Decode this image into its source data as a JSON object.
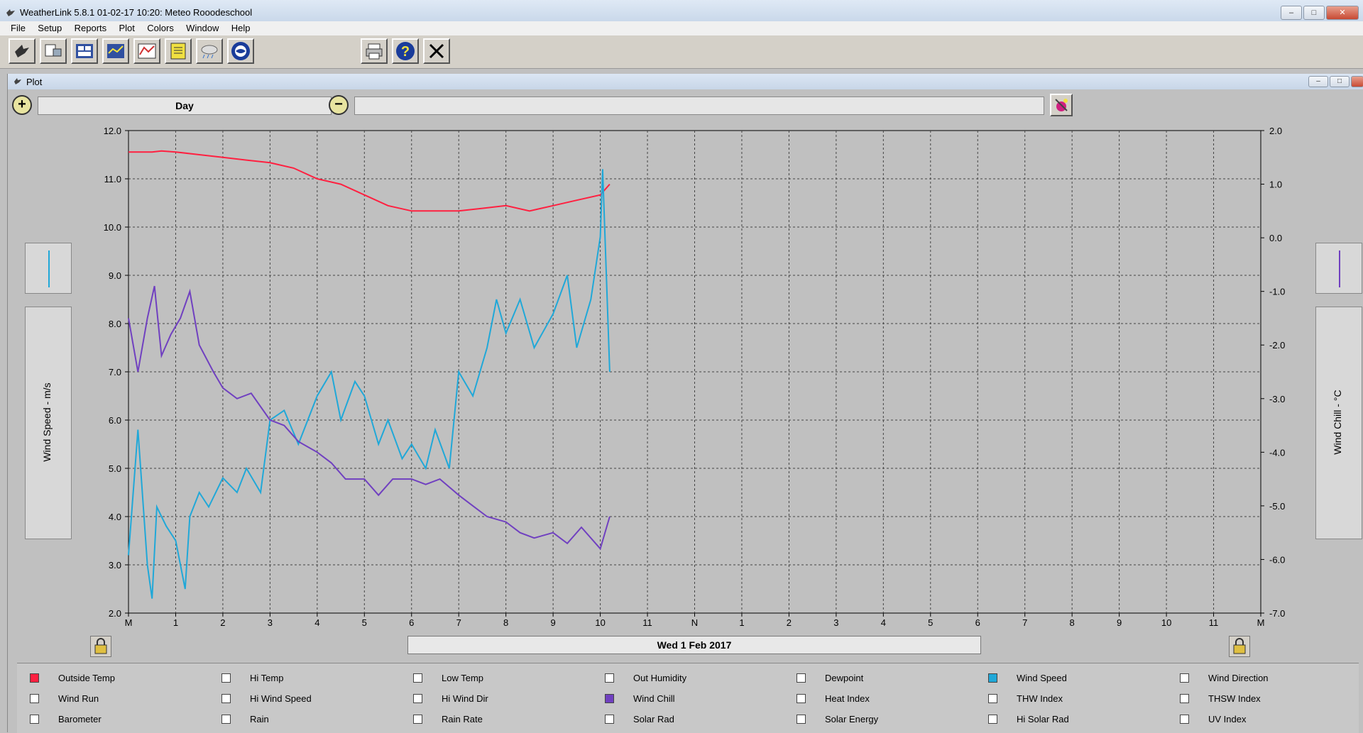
{
  "window": {
    "title": "WeatherLink 5.8.1  01-02-17  10:20: Meteo Rooodeschool"
  },
  "menu": [
    "File",
    "Setup",
    "Reports",
    "Plot",
    "Colors",
    "Window",
    "Help"
  ],
  "toolbar": {
    "buttons": [
      "download-icon",
      "station-icon",
      "bulletin-icon",
      "strip-chart-icon",
      "plot-icon",
      "notes-icon",
      "weather-icon",
      "noaa-icon"
    ],
    "right_buttons": [
      "print-icon",
      "help-icon",
      "close-icon"
    ]
  },
  "plot_window": {
    "title": "Plot",
    "period": "Day",
    "range_text": "",
    "date": "Wed 1 Feb 2017",
    "left_axis_label": "Wind Speed - m/s",
    "right_axis_label": "Wind Chill - °C"
  },
  "chart_data": {
    "type": "line",
    "x_ticks": [
      "M",
      "1",
      "2",
      "3",
      "4",
      "5",
      "6",
      "7",
      "8",
      "9",
      "10",
      "11",
      "N",
      "1",
      "2",
      "3",
      "4",
      "5",
      "6",
      "7",
      "8",
      "9",
      "10",
      "11",
      "M"
    ],
    "left_axis": {
      "ticks": [
        "12.0",
        "11.0",
        "10.0",
        "9.0",
        "8.0",
        "7.0",
        "6.0",
        "5.0",
        "4.0",
        "3.0",
        "2.0"
      ],
      "ylim": [
        2.0,
        12.0
      ]
    },
    "right_axis": {
      "ticks": [
        "2.0",
        "1.0",
        "0.0",
        "-1.0",
        "-2.0",
        "-3.0",
        "-4.0",
        "-5.0",
        "-6.0",
        "-7.0"
      ],
      "ylim": [
        -7.0,
        2.0
      ]
    },
    "grid": true,
    "series": [
      {
        "name": "Outside Temp",
        "color": "#ff2040",
        "axis": "right",
        "x": [
          0,
          0.5,
          0.7,
          1.0,
          1.5,
          2.0,
          2.5,
          3.0,
          3.5,
          4.0,
          4.5,
          5.0,
          5.5,
          6.0,
          6.5,
          7.0,
          7.5,
          8.0,
          8.5,
          9.0,
          9.5,
          10.0,
          10.2
        ],
        "values": [
          1.6,
          1.6,
          1.62,
          1.6,
          1.55,
          1.5,
          1.45,
          1.4,
          1.3,
          1.1,
          1.0,
          0.8,
          0.6,
          0.5,
          0.5,
          0.5,
          0.55,
          0.6,
          0.5,
          0.6,
          0.7,
          0.8,
          1.0
        ]
      },
      {
        "name": "Wind Speed",
        "color": "#20a8d8",
        "axis": "left",
        "x": [
          0,
          0.2,
          0.4,
          0.5,
          0.6,
          0.8,
          1.0,
          1.2,
          1.3,
          1.5,
          1.7,
          2.0,
          2.3,
          2.5,
          2.8,
          3.0,
          3.3,
          3.6,
          4.0,
          4.3,
          4.5,
          4.8,
          5.0,
          5.3,
          5.5,
          5.8,
          6.0,
          6.3,
          6.5,
          6.8,
          7.0,
          7.3,
          7.6,
          7.8,
          8.0,
          8.3,
          8.6,
          9.0,
          9.3,
          9.5,
          9.8,
          10.0,
          10.05,
          10.2
        ],
        "values": [
          3.2,
          5.8,
          3.0,
          2.3,
          4.2,
          3.8,
          3.5,
          2.5,
          4.0,
          4.5,
          4.2,
          4.8,
          4.5,
          5.0,
          4.5,
          6.0,
          6.2,
          5.5,
          6.5,
          7.0,
          6.0,
          6.8,
          6.5,
          5.5,
          6.0,
          5.2,
          5.5,
          5.0,
          5.8,
          5.0,
          7.0,
          6.5,
          7.5,
          8.5,
          7.8,
          8.5,
          7.5,
          8.2,
          9.0,
          7.5,
          8.5,
          9.8,
          11.2,
          7.0
        ]
      },
      {
        "name": "Wind Chill",
        "color": "#7040c0",
        "axis": "right",
        "x": [
          0,
          0.2,
          0.4,
          0.55,
          0.7,
          0.9,
          1.1,
          1.3,
          1.5,
          1.8,
          2.0,
          2.3,
          2.6,
          3.0,
          3.3,
          3.6,
          4.0,
          4.3,
          4.6,
          5.0,
          5.3,
          5.6,
          6.0,
          6.3,
          6.6,
          7.0,
          7.3,
          7.6,
          8.0,
          8.3,
          8.6,
          9.0,
          9.3,
          9.6,
          10.0,
          10.2
        ],
        "values": [
          -1.5,
          -2.5,
          -1.5,
          -0.9,
          -2.2,
          -1.8,
          -1.5,
          -1.0,
          -2.0,
          -2.5,
          -2.8,
          -3.0,
          -2.9,
          -3.4,
          -3.5,
          -3.8,
          -4.0,
          -4.2,
          -4.5,
          -4.5,
          -4.8,
          -4.5,
          -4.5,
          -4.6,
          -4.5,
          -4.8,
          -5.0,
          -5.2,
          -5.3,
          -5.5,
          -5.6,
          -5.5,
          -5.7,
          -5.4,
          -5.8,
          -5.2
        ]
      }
    ]
  },
  "legend": [
    {
      "label": "Outside Temp",
      "checked": true,
      "color": "#ff2040"
    },
    {
      "label": "Hi Temp",
      "checked": false
    },
    {
      "label": "Low Temp",
      "checked": false
    },
    {
      "label": "Out Humidity",
      "checked": false
    },
    {
      "label": "Dewpoint",
      "checked": false
    },
    {
      "label": "Wind Speed",
      "checked": true,
      "color": "#20a8d8"
    },
    {
      "label": "Wind Direction",
      "checked": false
    },
    {
      "label": "Wind Run",
      "checked": false
    },
    {
      "label": "Hi Wind Speed",
      "checked": false
    },
    {
      "label": "Hi Wind Dir",
      "checked": false
    },
    {
      "label": "Wind Chill",
      "checked": true,
      "color": "#7040c0"
    },
    {
      "label": "Heat Index",
      "checked": false
    },
    {
      "label": "THW Index",
      "checked": false
    },
    {
      "label": "THSW Index",
      "checked": false
    },
    {
      "label": "Barometer",
      "checked": false
    },
    {
      "label": "Rain",
      "checked": false
    },
    {
      "label": "Rain Rate",
      "checked": false
    },
    {
      "label": "Solar Rad",
      "checked": false
    },
    {
      "label": "Solar Energy",
      "checked": false
    },
    {
      "label": "Hi Solar Rad",
      "checked": false
    },
    {
      "label": "UV Index",
      "checked": false
    }
  ]
}
